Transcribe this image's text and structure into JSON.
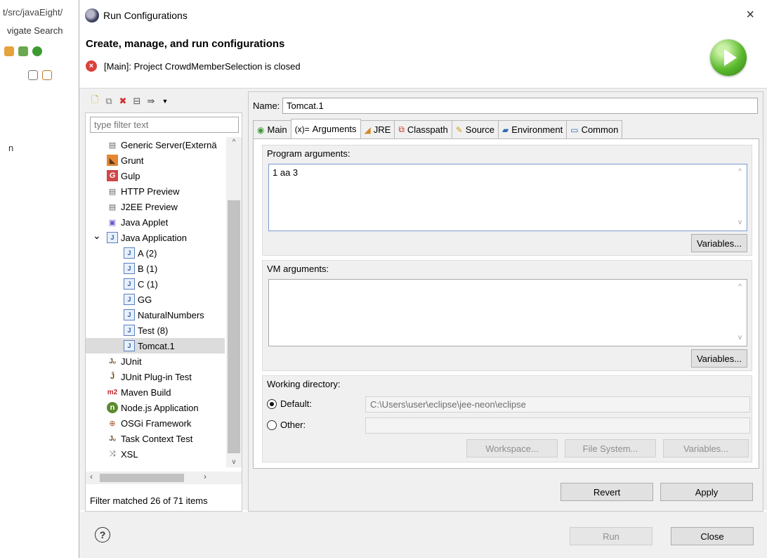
{
  "background_ide": {
    "path": "t/src/javaEight/",
    "menu": "vigate  Search",
    "fragment": "n"
  },
  "dialog": {
    "title": "Run Configurations",
    "close": "×"
  },
  "header": {
    "title": "Create, manage, and run configurations",
    "message": "[Main]: Project CrowdMemberSelection is closed"
  },
  "left": {
    "filter_placeholder": "type filter text",
    "tree": [
      {
        "label": "Generic Server(Externä",
        "icon": "server-icon",
        "indent": 0
      },
      {
        "label": "Grunt",
        "icon": "grunt-icon",
        "indent": 0
      },
      {
        "label": "Gulp",
        "icon": "gulp-icon",
        "indent": 0
      },
      {
        "label": "HTTP Preview",
        "icon": "server-icon",
        "indent": 0
      },
      {
        "label": "J2EE Preview",
        "icon": "server-icon",
        "indent": 0
      },
      {
        "label": "Java Applet",
        "icon": "applet-icon",
        "indent": 0
      },
      {
        "label": "Java Application",
        "icon": "java-icon",
        "indent": 0,
        "expanded": true
      },
      {
        "label": "A (2)",
        "icon": "java-icon",
        "indent": 1
      },
      {
        "label": "B (1)",
        "icon": "java-icon",
        "indent": 1
      },
      {
        "label": "C (1)",
        "icon": "java-icon",
        "indent": 1
      },
      {
        "label": "GG",
        "icon": "java-icon",
        "indent": 1
      },
      {
        "label": "NaturalNumbers",
        "icon": "java-icon",
        "indent": 1
      },
      {
        "label": "Test (8)",
        "icon": "java-icon",
        "indent": 1
      },
      {
        "label": "Tomcat.1",
        "icon": "java-icon",
        "indent": 1,
        "selected": true
      },
      {
        "label": "JUnit",
        "icon": "junit-icon",
        "indent": 0
      },
      {
        "label": "JUnit Plug-in Test",
        "icon": "junit-plugin-icon",
        "indent": 0
      },
      {
        "label": "Maven Build",
        "icon": "maven-icon",
        "indent": 0
      },
      {
        "label": "Node.js Application",
        "icon": "nodejs-icon",
        "indent": 0
      },
      {
        "label": "OSGi Framework",
        "icon": "osgi-icon",
        "indent": 0
      },
      {
        "label": "Task Context Test",
        "icon": "task-icon",
        "indent": 0
      },
      {
        "label": "XSL",
        "icon": "xsl-icon",
        "indent": 0
      }
    ],
    "status": "Filter matched 26 of 71 items"
  },
  "right": {
    "name_label": "Name:",
    "name_value": "Tomcat.1",
    "tabs": [
      {
        "label": "Main",
        "icon": "main-tab-icon"
      },
      {
        "label": "Arguments",
        "icon": "arguments-tab-icon",
        "prefix": "(x)=",
        "active": true
      },
      {
        "label": "JRE",
        "icon": "jre-tab-icon"
      },
      {
        "label": "Classpath",
        "icon": "classpath-tab-icon"
      },
      {
        "label": "Source",
        "icon": "source-tab-icon"
      },
      {
        "label": "Environment",
        "icon": "environment-tab-icon"
      },
      {
        "label": "Common",
        "icon": "common-tab-icon"
      }
    ],
    "program_args_label": "Program arguments:",
    "program_args_value": "1 aa 3",
    "variables_label": "Variables...",
    "vm_args_label": "VM arguments:",
    "vm_args_value": "",
    "working_dir_label": "Working directory:",
    "default_label": "Default:",
    "default_value": "C:\\Users\\user\\eclipse\\jee-neon\\eclipse",
    "other_label": "Other:",
    "workspace_btn": "Workspace...",
    "filesystem_btn": "File System...",
    "variables_btn": "Variables...",
    "revert_btn": "Revert",
    "apply_btn": "Apply"
  },
  "footer": {
    "help": "?",
    "run_btn": "Run",
    "close_btn": "Close"
  },
  "colors": {
    "accent_green": "#5cba2e",
    "error_red": "#d9413c",
    "panel_bg": "#f0f0f0"
  }
}
